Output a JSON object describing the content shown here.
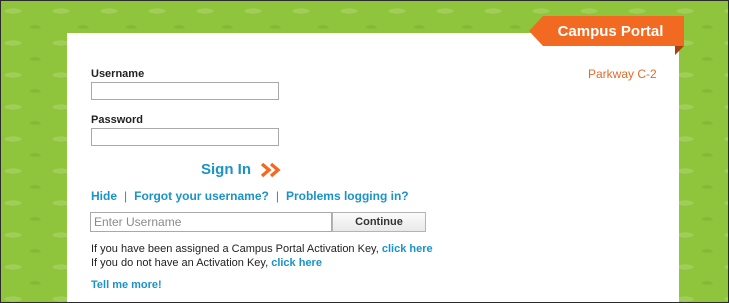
{
  "header": {
    "portal_title": "Campus Portal",
    "district": "Parkway C-2"
  },
  "login": {
    "username_label": "Username",
    "username_value": "",
    "password_label": "Password",
    "password_value": "",
    "sign_in_label": "Sign In",
    "sign_in_icon": "double-chevron-right-icon"
  },
  "links": {
    "hide": "Hide",
    "separator": "|",
    "forgot_username": "Forgot your username?",
    "problems_logging_in": "Problems logging in?"
  },
  "username_lookup": {
    "placeholder": "Enter Username",
    "continue_label": "Continue"
  },
  "activation": {
    "assigned_text": "If you have been assigned a Campus Portal Activation Key,",
    "assigned_link": "click here",
    "no_key_text": "If you do not have an Activation Key,",
    "no_key_link": "click here"
  },
  "tell_me_more": "Tell me more!",
  "colors": {
    "background_green": "#8fc53c",
    "tab_orange": "#f26a22",
    "district_orange": "#e36a2a",
    "link_blue": "#1a93c8"
  }
}
